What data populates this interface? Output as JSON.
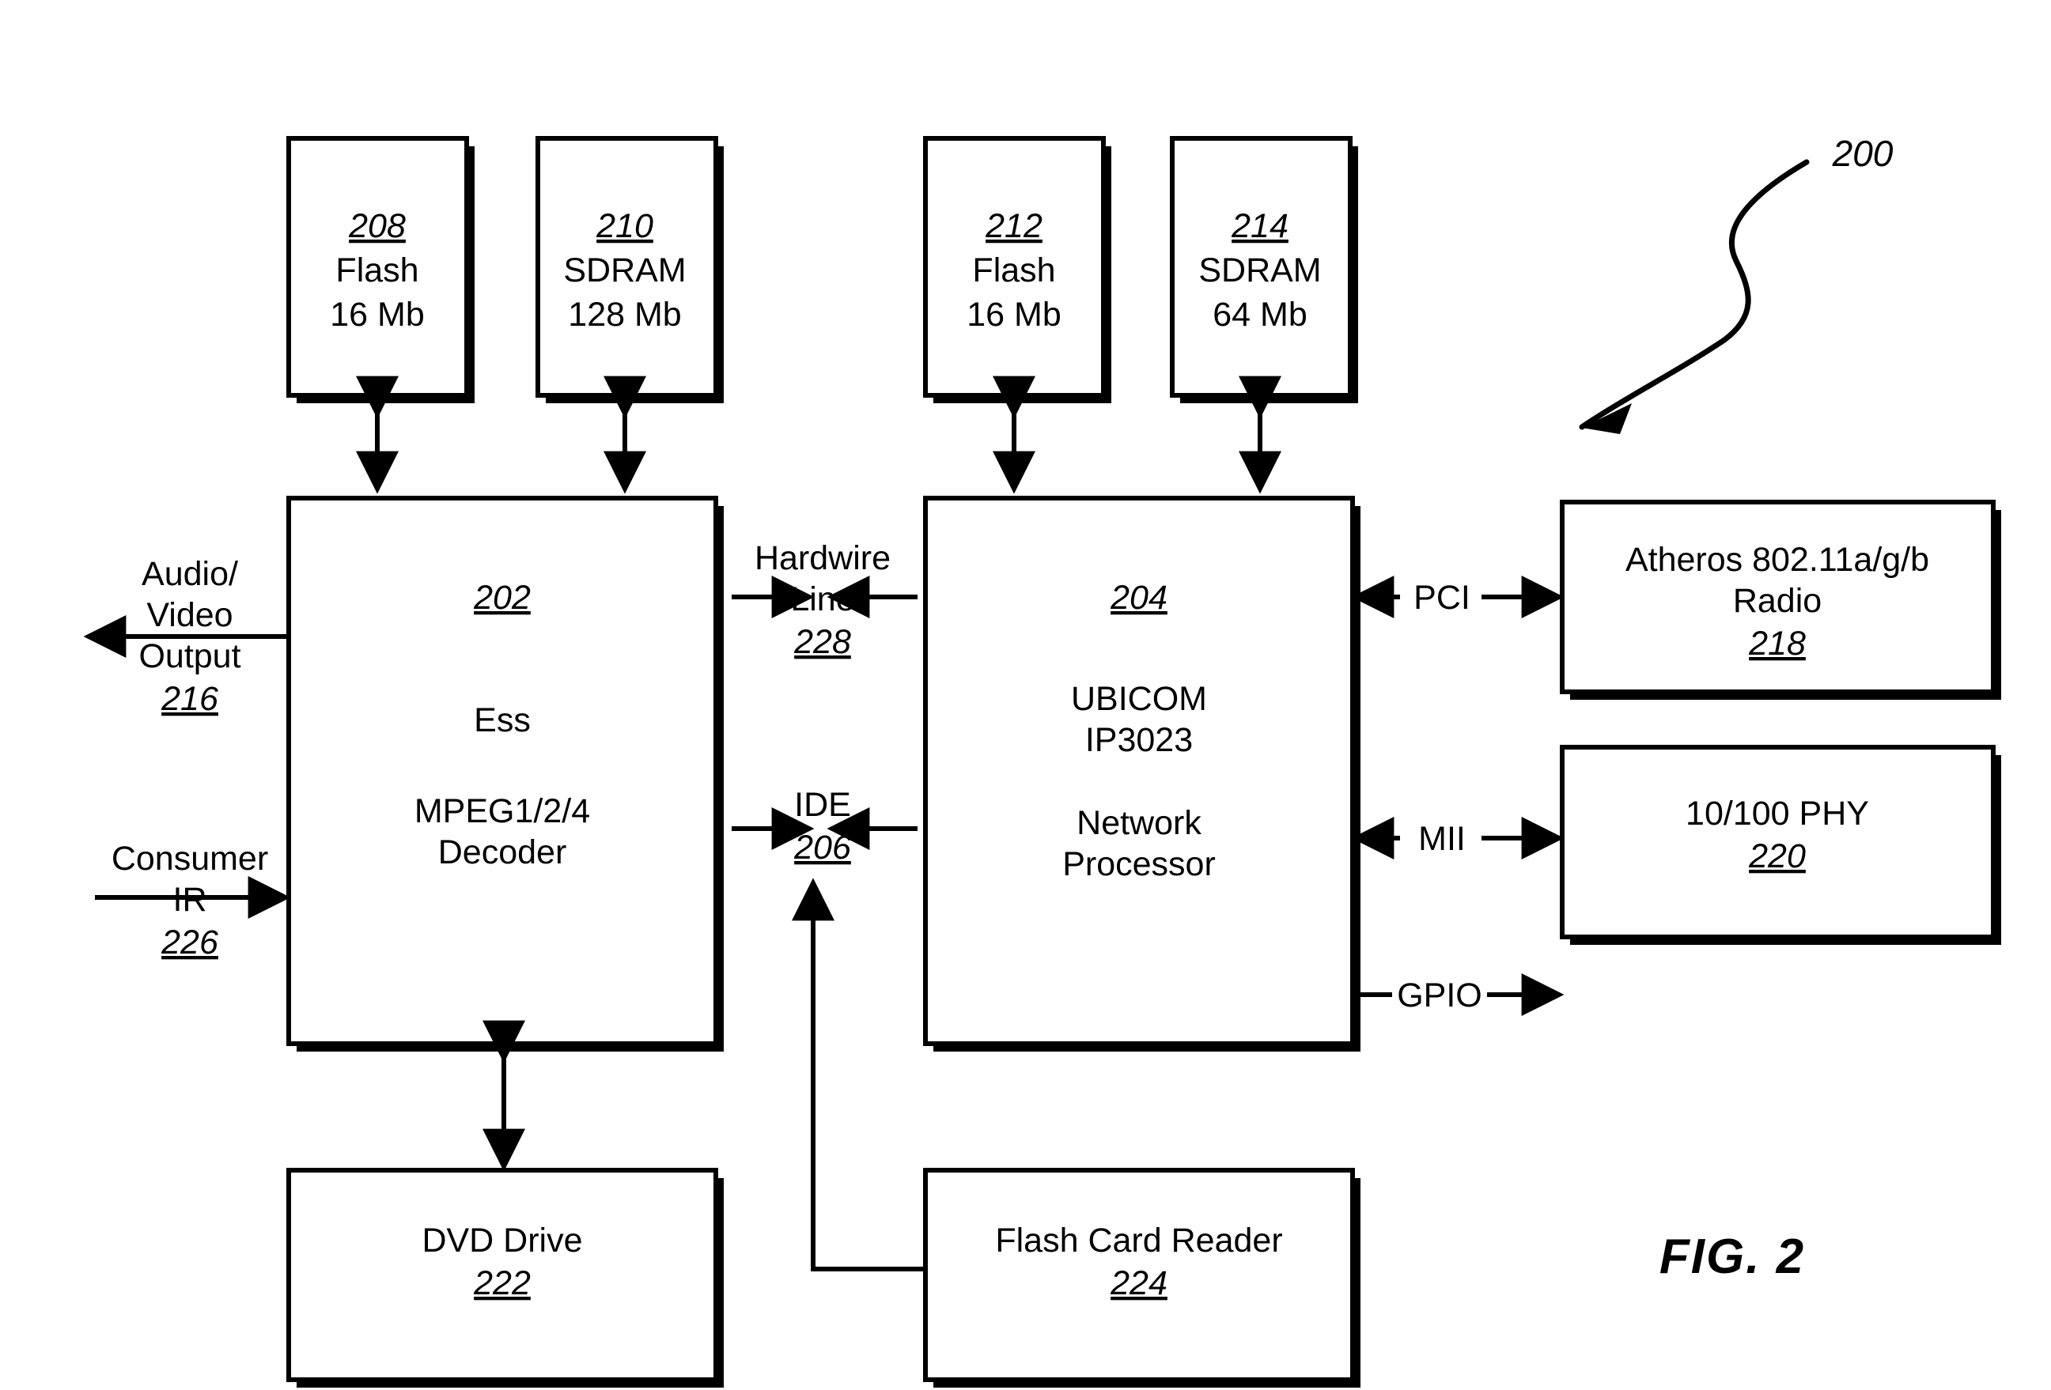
{
  "figure": {
    "label": "FIG. 2",
    "system_ref": "200"
  },
  "blocks": {
    "flash_left": {
      "ref": "208",
      "line1": "Flash",
      "line2": "16 Mb"
    },
    "sdram_left": {
      "ref": "210",
      "line1": "SDRAM",
      "line2": "128 Mb"
    },
    "flash_right": {
      "ref": "212",
      "line1": "Flash",
      "line2": "16 Mb"
    },
    "sdram_right": {
      "ref": "214",
      "line1": "SDRAM",
      "line2": "64 Mb"
    },
    "decoder": {
      "ref": "202",
      "line1": "Ess",
      "line2": "MPEG1/2/4",
      "line3": "Decoder"
    },
    "network_processor": {
      "ref": "204",
      "line1": "UBICOM",
      "line2": "IP3023",
      "line3": "Network",
      "line4": "Processor"
    },
    "radio": {
      "ref": "218",
      "line1": "Atheros 802.11a/g/b",
      "line2": "Radio"
    },
    "phy": {
      "ref": "220",
      "line1": "10/100 PHY"
    },
    "dvd": {
      "ref": "222",
      "line1": "DVD Drive"
    },
    "card_reader": {
      "ref": "224",
      "line1": "Flash Card Reader"
    }
  },
  "connections": {
    "av_output": {
      "line1": "Audio/",
      "line2": "Video",
      "line3": "Output",
      "ref": "216"
    },
    "consumer_ir": {
      "line1": "Consumer",
      "line2": "IR",
      "ref": "226"
    },
    "hardwire_line": {
      "line1": "Hardwire",
      "line2": "Line",
      "ref": "228"
    },
    "ide": {
      "line1": "IDE",
      "ref": "206"
    },
    "pci": {
      "label": "PCI"
    },
    "mii": {
      "label": "MII"
    },
    "gpio": {
      "label": "GPIO"
    }
  },
  "colors": {
    "ink": "#000000",
    "paper": "#ffffff"
  }
}
